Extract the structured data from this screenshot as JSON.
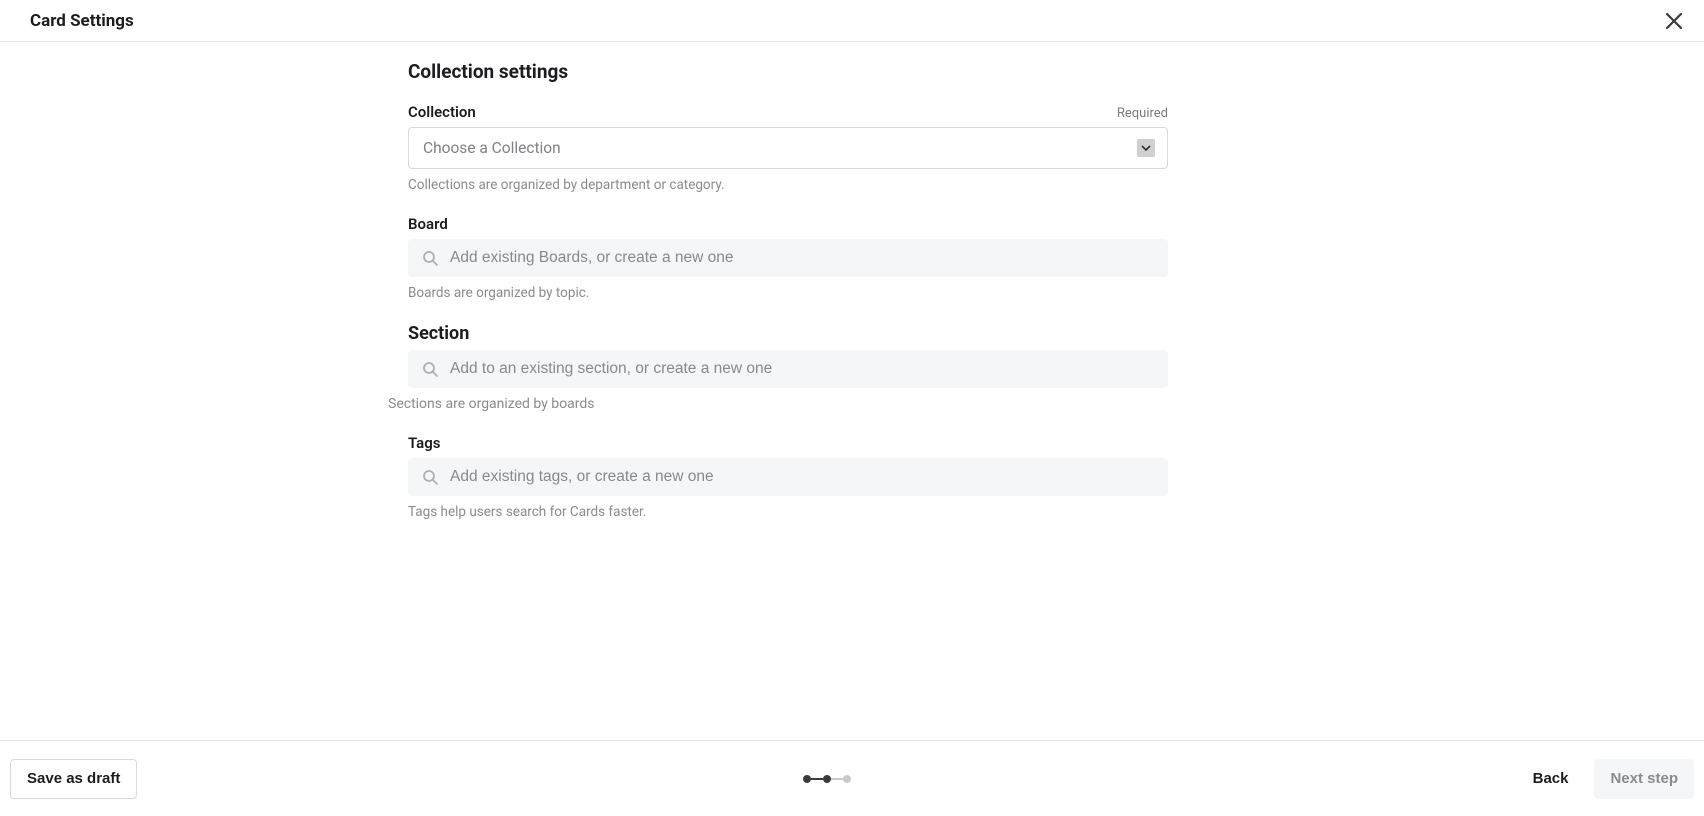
{
  "header": {
    "title": "Card Settings"
  },
  "main": {
    "title": "Collection settings",
    "collection": {
      "label": "Collection",
      "required_text": "Required",
      "placeholder": "Choose a Collection",
      "help": "Collections are organized by department or category."
    },
    "board": {
      "label": "Board",
      "placeholder": "Add existing Boards, or create a new one",
      "help": "Boards are organized by topic."
    },
    "section": {
      "label": "Section",
      "placeholder": "Add to an existing section, or create a new one",
      "help": "Sections are organized by boards"
    },
    "tags": {
      "label": "Tags",
      "placeholder": "Add existing tags, or create a new one",
      "help": "Tags help users search for Cards faster."
    }
  },
  "footer": {
    "save_draft": "Save as draft",
    "back": "Back",
    "next": "Next step",
    "step_current": 2,
    "step_total": 3
  }
}
